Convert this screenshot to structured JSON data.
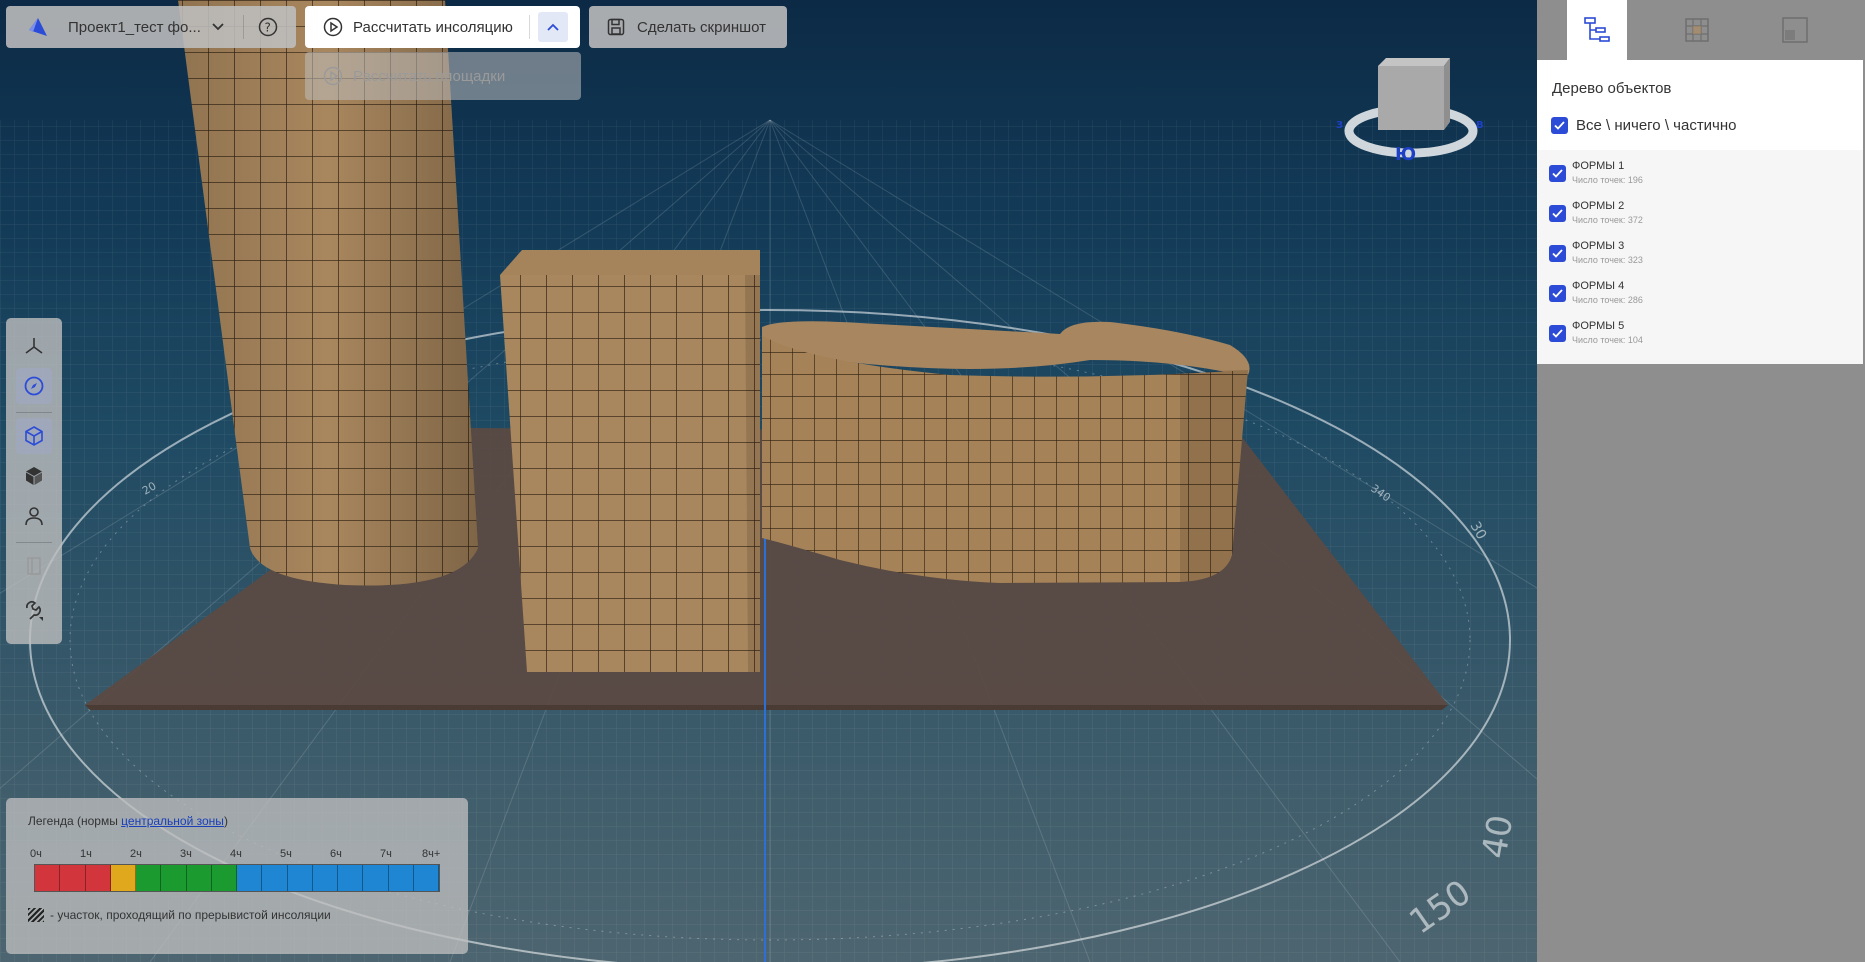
{
  "toolbar": {
    "project_name": "Проект1_тест фо...",
    "calc_insolation_label": "Рассчитать инсоляцию",
    "screenshot_label": "Сделать скриншот",
    "calc_areas_label": "Рассчитать площадки"
  },
  "compass": {
    "south_label": "Ю",
    "west_label": "З",
    "east_label": "В"
  },
  "scene": {
    "dial_labels": [
      "150",
      "40",
      "30",
      "340",
      "20"
    ]
  },
  "left_tools": {
    "icons": [
      "axes-icon",
      "compass-icon",
      "cube-outline-icon",
      "cube-solid-icon",
      "person-icon",
      "panel-icon",
      "wrench-icon"
    ]
  },
  "legend": {
    "title_prefix": "Легенда (нормы ",
    "title_link": "центральной зоны",
    "title_suffix": ")",
    "ticks": [
      "0ч",
      "1ч",
      "2ч",
      "3ч",
      "4ч",
      "5ч",
      "6ч",
      "7ч",
      "8ч+"
    ],
    "segments": [
      "#d2353b",
      "#d2353b",
      "#d2353b",
      "#e0a81c",
      "#1b9a2f",
      "#1b9a2f",
      "#1b9a2f",
      "#1b9a2f",
      "#1f86d3",
      "#1f86d3",
      "#1f86d3",
      "#1f86d3",
      "#1f86d3",
      "#1f86d3",
      "#1f86d3",
      "#1f86d3"
    ],
    "note": "- участок, проходящий по прерывистой инсоляции"
  },
  "object_tree": {
    "title": "Дерево объектов",
    "all_label": "Все \\ ничего \\ частично",
    "items": [
      {
        "name": "ФОРМЫ 1",
        "points": "Число точек: 196"
      },
      {
        "name": "ФОРМЫ 2",
        "points": "Число точек: 372"
      },
      {
        "name": "ФОРМЫ 3",
        "points": "Число точек: 323"
      },
      {
        "name": "ФОРМЫ 4",
        "points": "Число точек: 286"
      },
      {
        "name": "ФОРМЫ 5",
        "points": "Число точек: 104"
      }
    ]
  },
  "colors": {
    "accent": "#2c4bd6",
    "building": "#a9875e",
    "ground": "#5b4a43"
  }
}
